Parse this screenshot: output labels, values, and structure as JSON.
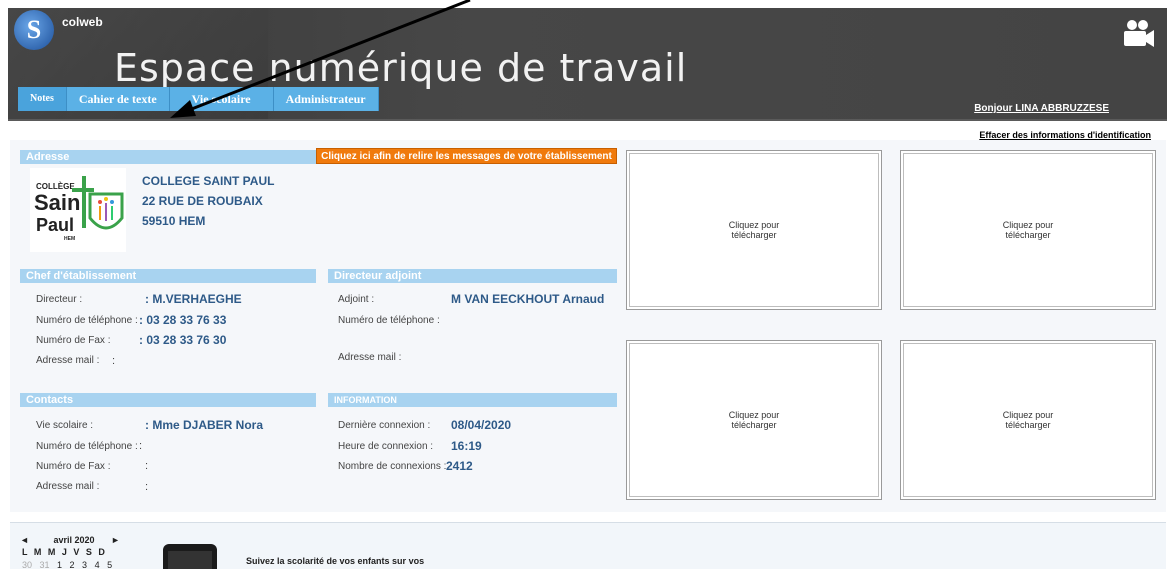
{
  "header": {
    "logo_letter": "S",
    "logo_text": "colweb",
    "title": "Espace numérique de travail",
    "greeting": "Bonjour LINA ABBRUZZESE"
  },
  "tabs": [
    {
      "label": "Notes"
    },
    {
      "label": "Cahier de texte"
    },
    {
      "label": "Vie scolaire"
    },
    {
      "label": "Administrateur"
    }
  ],
  "clear_link": "Effacer des informations d'identification",
  "alert": "Cliquez ici afin de relire les messages de votre établissement",
  "address": {
    "heading": "Adresse",
    "line1": "COLLEGE SAINT PAUL",
    "line2": "22 RUE DE ROUBAIX",
    "line3": "59510 HEM"
  },
  "school_logo": {
    "top": "COLLÈGE",
    "mid1": "Saint",
    "mid2": "Paul",
    "bottom": "HEM"
  },
  "chef": {
    "heading": "Chef d'établissement",
    "rows": [
      {
        "label": "Directeur :",
        "value": ": M.VERHAEGHE"
      },
      {
        "label": "Numéro de téléphone :",
        "value": ": 03 28 33 76 33"
      },
      {
        "label": "Numéro de Fax :",
        "value": ": 03 28 33 76 30"
      },
      {
        "label": "Adresse mail :",
        "value": ":"
      }
    ]
  },
  "adjoint": {
    "heading": "Directeur adjoint",
    "rows": [
      {
        "label": "Adjoint :",
        "value": "M VAN EECKHOUT Arnaud"
      },
      {
        "label": "Numéro de téléphone :",
        "value": ""
      },
      {
        "label": "Adresse mail :",
        "value": ""
      }
    ]
  },
  "contacts": {
    "heading": "Contacts",
    "rows": [
      {
        "label": "Vie scolaire :",
        "value": ": Mme DJABER Nora"
      },
      {
        "label": "Numéro de téléphone :",
        "value": ":"
      },
      {
        "label": "Numéro de Fax :",
        "value": ":"
      },
      {
        "label": "Adresse mail :",
        "value": ":"
      }
    ]
  },
  "information": {
    "heading": "INFORMATION",
    "rows": [
      {
        "label": "Dernière connexion :",
        "value": "08/04/2020"
      },
      {
        "label": "Heure de connexion :",
        "value": "16:19"
      },
      {
        "label": "Nombre de connexions :",
        "value": "2412"
      }
    ]
  },
  "downloads": [
    {
      "line1": "Cliquez pour",
      "line2": "télécharger"
    },
    {
      "line1": "Cliquez pour",
      "line2": "télécharger"
    },
    {
      "line1": "Cliquez pour",
      "line2": "télécharger"
    },
    {
      "line1": "Cliquez pour",
      "line2": "télécharger"
    }
  ],
  "calendar": {
    "prev": "◄",
    "month": "avril 2020",
    "next": "►",
    "days": "L M M J V S D",
    "prev_days": "30 31",
    "days_nums": "1 2 3 4 5"
  },
  "promo": "Suivez la scolarité de vos enfants sur vos",
  "colors": {
    "tab": "#5bb1e6",
    "bar": "#a8d3f0",
    "alert": "#f07a0c",
    "value": "#2e5a88"
  },
  "icons": [
    "camera-icon",
    "annotation-arrow"
  ]
}
